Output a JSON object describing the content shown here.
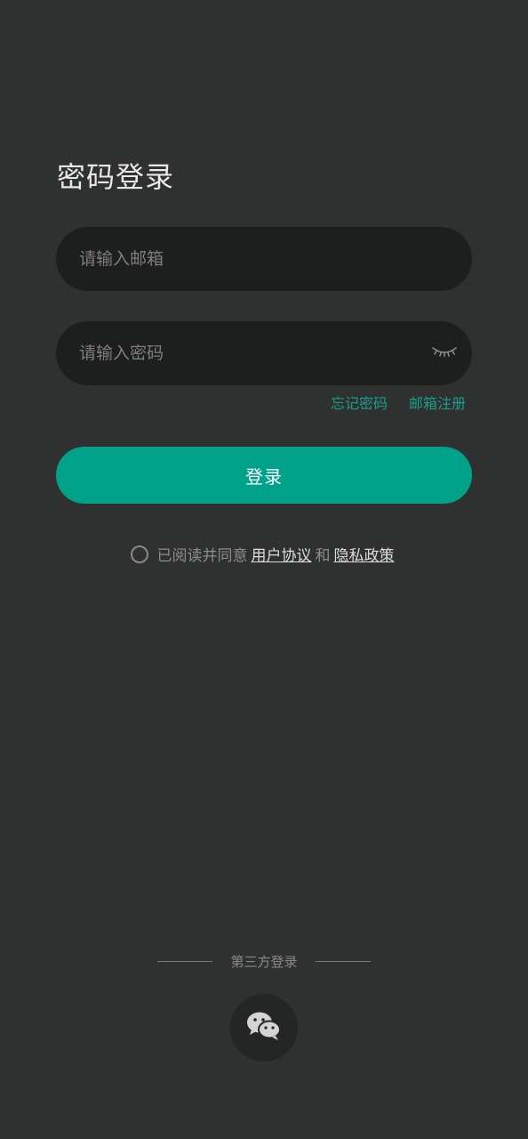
{
  "page": {
    "title": "密码登录"
  },
  "form": {
    "email_placeholder": "请输入邮箱",
    "password_placeholder": "请输入密码",
    "password_visibility_icon": "eye-closed-icon",
    "forgot_password": "忘记密码",
    "email_register": "邮箱注册",
    "login_button": "登录"
  },
  "agreement": {
    "prefix": "已阅读并同意",
    "user_agreement": "用户协议",
    "and": "和",
    "privacy_policy": "隐私政策"
  },
  "third_party": {
    "label": "第三方登录",
    "wechat_icon": "wechat-icon"
  },
  "colors": {
    "background": "#2f3030",
    "input_background": "#1d1e1e",
    "accent": "#01a28a",
    "link": "#1a9e8b"
  }
}
